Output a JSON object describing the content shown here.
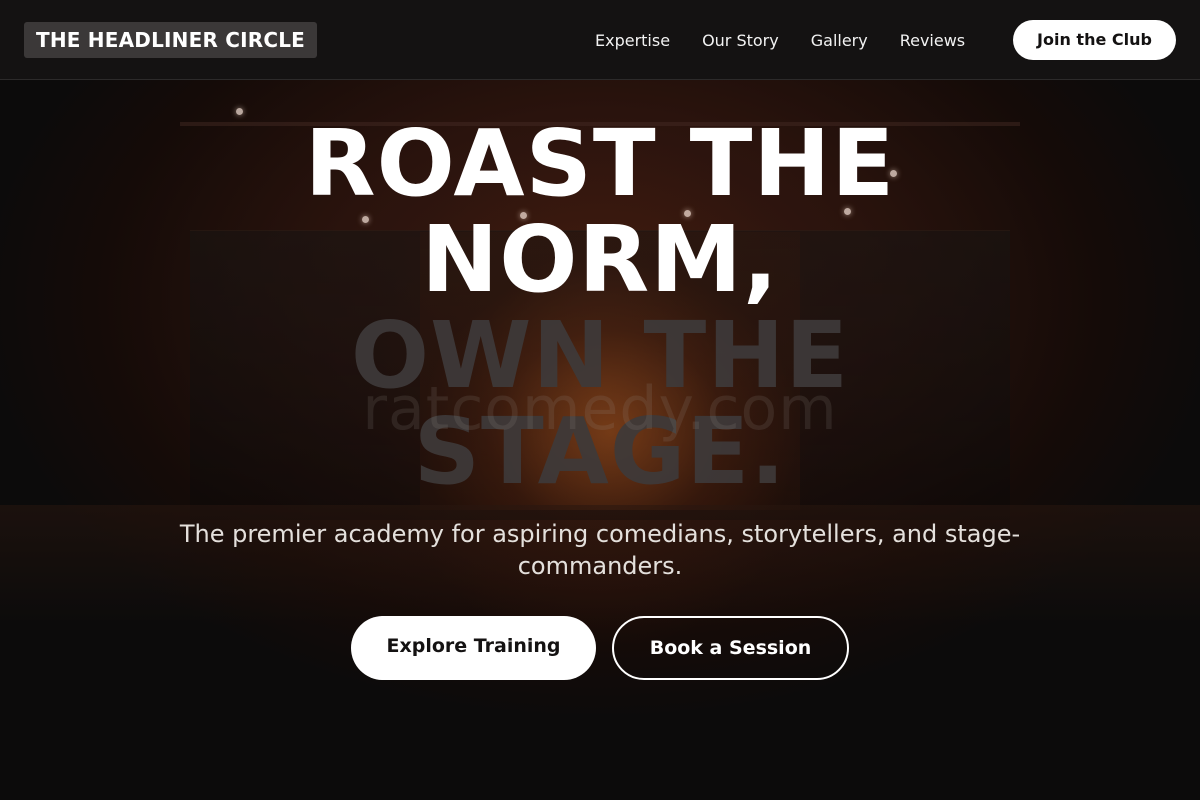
{
  "nav": {
    "logo": "THE HEADLINER CIRCLE",
    "links": [
      "Expertise",
      "Our Story",
      "Gallery",
      "Reviews"
    ],
    "cta": "Join the Club"
  },
  "hero": {
    "headline_light": [
      "ROAST THE",
      "NORM,"
    ],
    "headline_dark": [
      "OWN THE",
      "STAGE."
    ],
    "watermark": "ratcomedy.com",
    "subtitle": "The premier academy for aspiring comedians, storytellers, and stage-commanders.",
    "primary_button": "Explore Training",
    "secondary_button": "Book a Session"
  },
  "colors": {
    "background": "#0c0b0b",
    "navbar": "#141212",
    "logo_bg": "#3b3838",
    "headline_dark": "#3e3a3a",
    "button_light": "#ffffff"
  }
}
